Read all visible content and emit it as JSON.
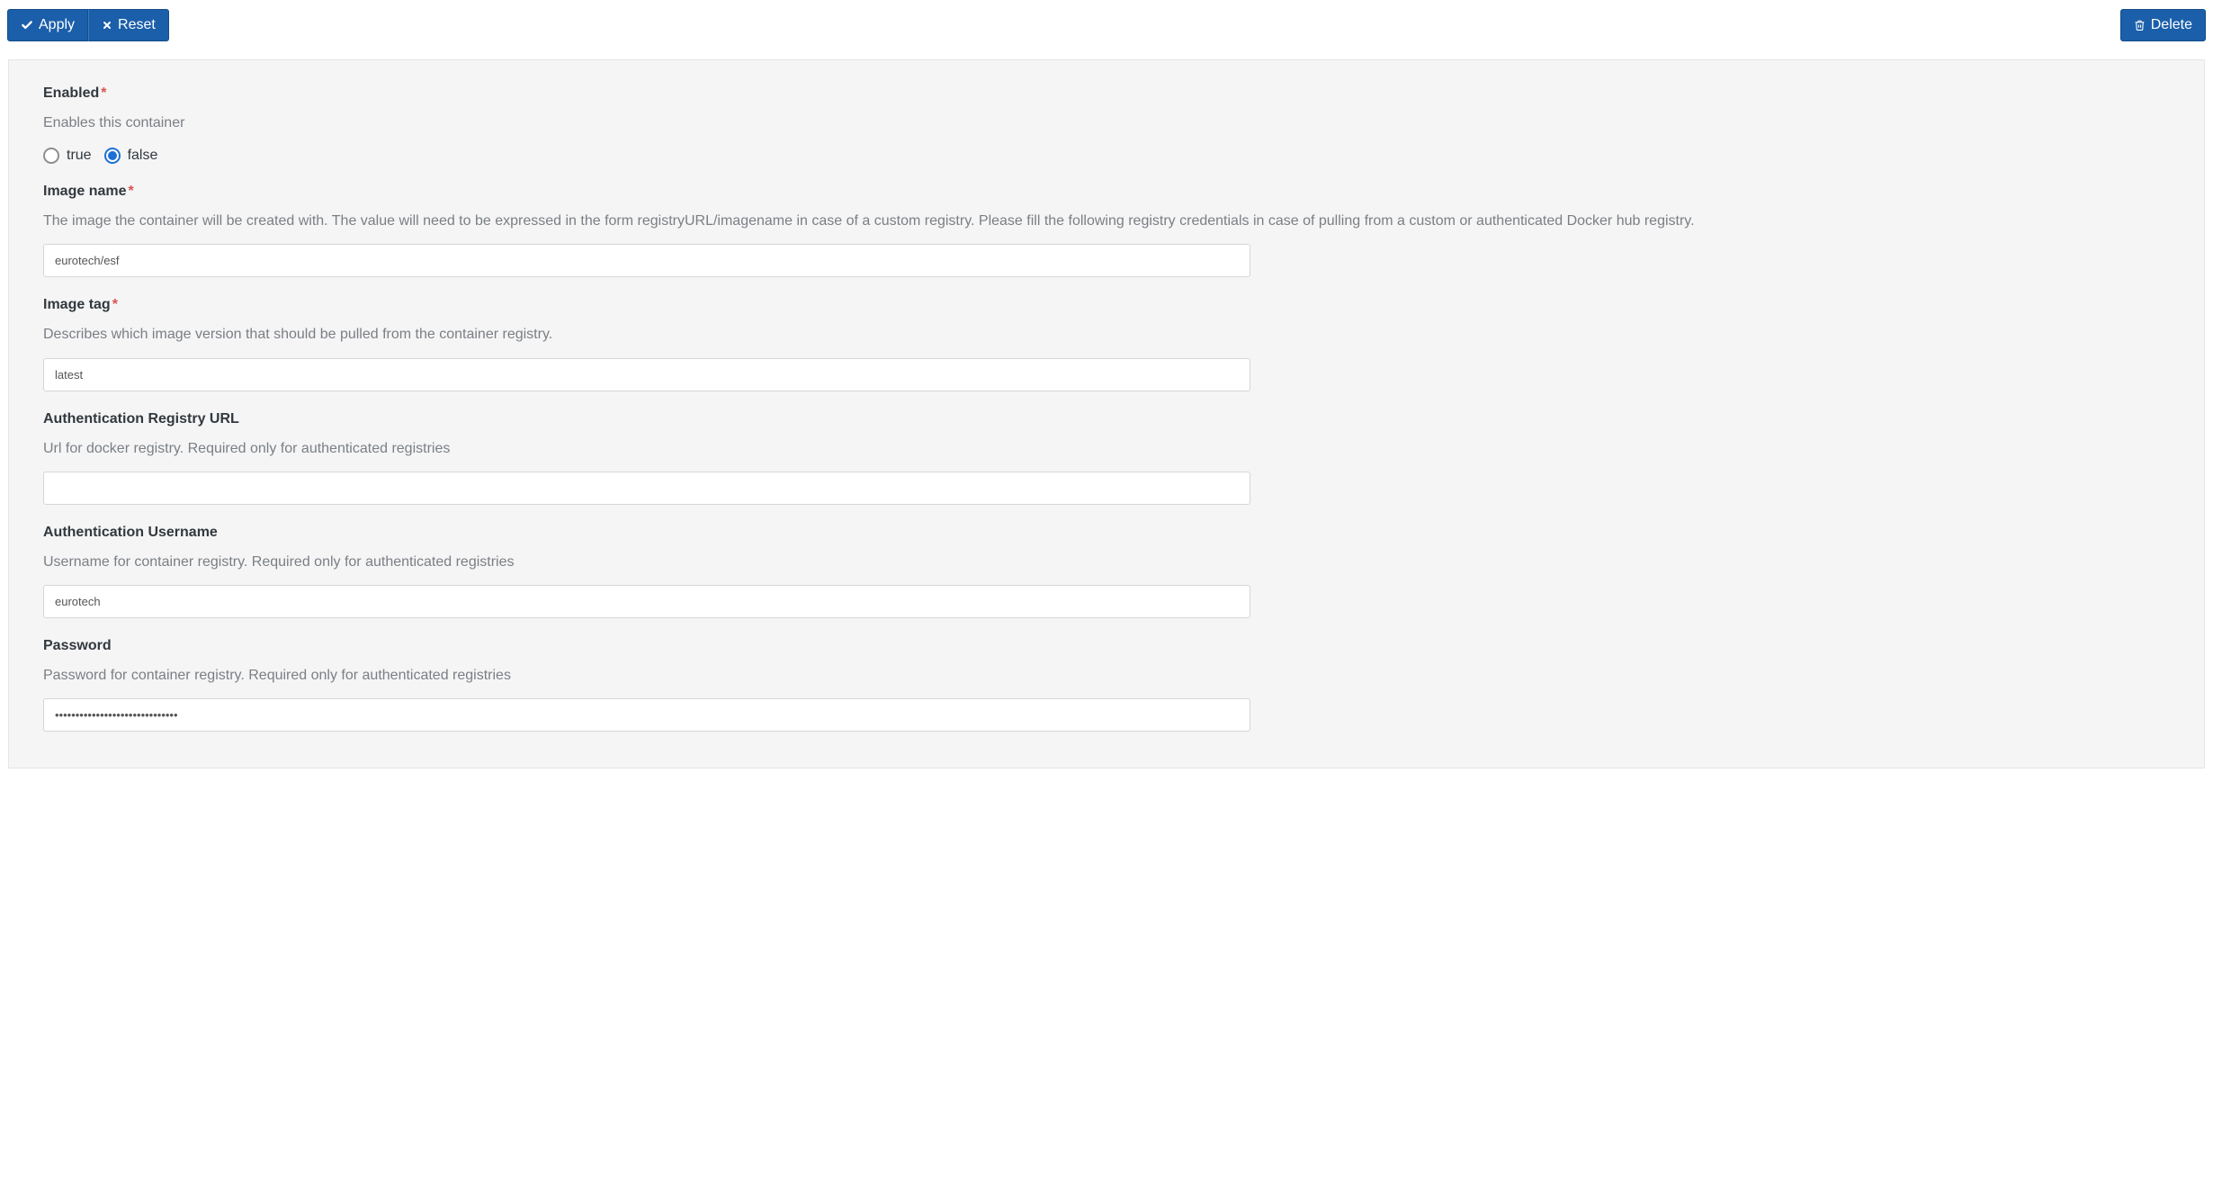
{
  "toolbar": {
    "apply_label": "Apply",
    "reset_label": "Reset",
    "delete_label": "Delete"
  },
  "fields": {
    "enabled": {
      "label": "Enabled",
      "required": true,
      "desc": "Enables this container",
      "option_true": "true",
      "option_false": "false",
      "value": "false"
    },
    "image_name": {
      "label": "Image name",
      "required": true,
      "desc": "The image the container will be created with. The value will need to be expressed in the form registryURL/imagename in case of a custom registry. Please fill the following registry credentials in case of pulling from a custom or authenticated Docker hub registry.",
      "value": "eurotech/esf"
    },
    "image_tag": {
      "label": "Image tag",
      "required": true,
      "desc": "Describes which image version that should be pulled from the container registry.",
      "value": "latest"
    },
    "auth_registry_url": {
      "label": "Authentication Registry URL",
      "required": false,
      "desc": "Url for docker registry. Required only for authenticated registries",
      "value": ""
    },
    "auth_username": {
      "label": "Authentication Username",
      "required": false,
      "desc": "Username for container registry. Required only for authenticated registries",
      "value": "eurotech"
    },
    "password": {
      "label": "Password",
      "required": false,
      "desc": "Password for container registry. Required only for authenticated registries",
      "value": "••••••••••••••••••••••••••••••"
    }
  }
}
